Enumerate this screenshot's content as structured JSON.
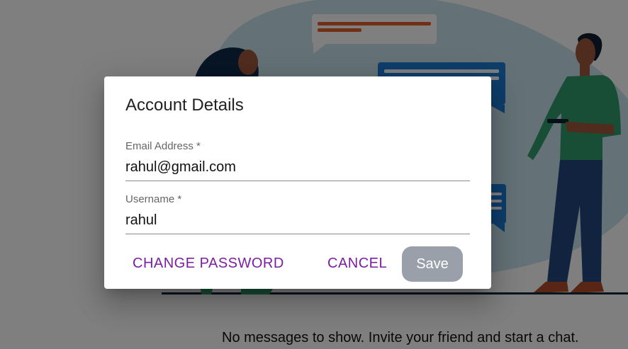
{
  "background": {
    "empty_message": "No messages to show. Invite your friend and start a chat."
  },
  "dialog": {
    "title": "Account Details",
    "email": {
      "label": "Email Address *",
      "value": "rahul@gmail.com"
    },
    "username": {
      "label": "Username *",
      "value": "rahul"
    },
    "change_password_label": "CHANGE PASSWORD",
    "cancel_label": "CANCEL",
    "save_label": "Save"
  },
  "colors": {
    "accent": "#7b1fa2",
    "save_disabled": "#9aa0aa",
    "overlay": "rgba(0,0,0,0.5)"
  }
}
